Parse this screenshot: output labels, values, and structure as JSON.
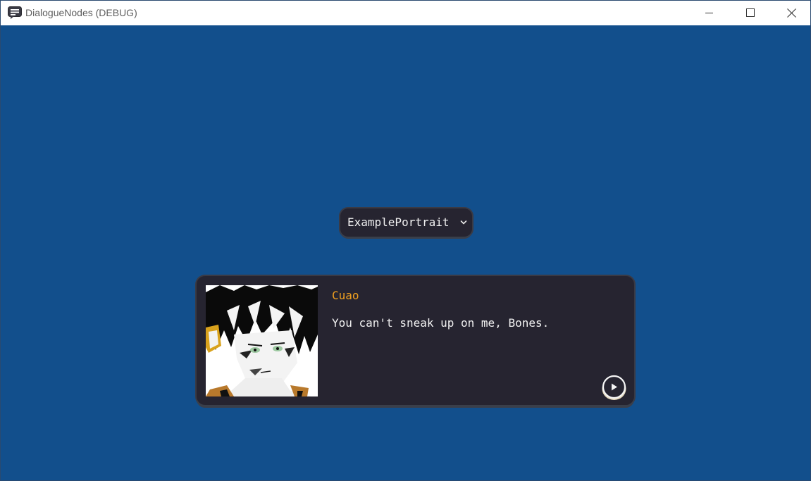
{
  "window": {
    "title": "DialogueNodes (DEBUG)",
    "icon": "chat-bubble-icon",
    "controls": [
      "minimize-icon",
      "maximize-icon",
      "close-icon"
    ]
  },
  "scene": {
    "background_color": "#124f8c",
    "portrait_dropdown": {
      "selected": "ExamplePortrait",
      "icon": "chevron-down-icon"
    },
    "dialogue": {
      "speaker": "Cuao",
      "speaker_color": "#f0a020",
      "text": "You can't sneak up on me, Bones.",
      "portrait": "character-portrait",
      "next_icon": "play-icon"
    }
  }
}
